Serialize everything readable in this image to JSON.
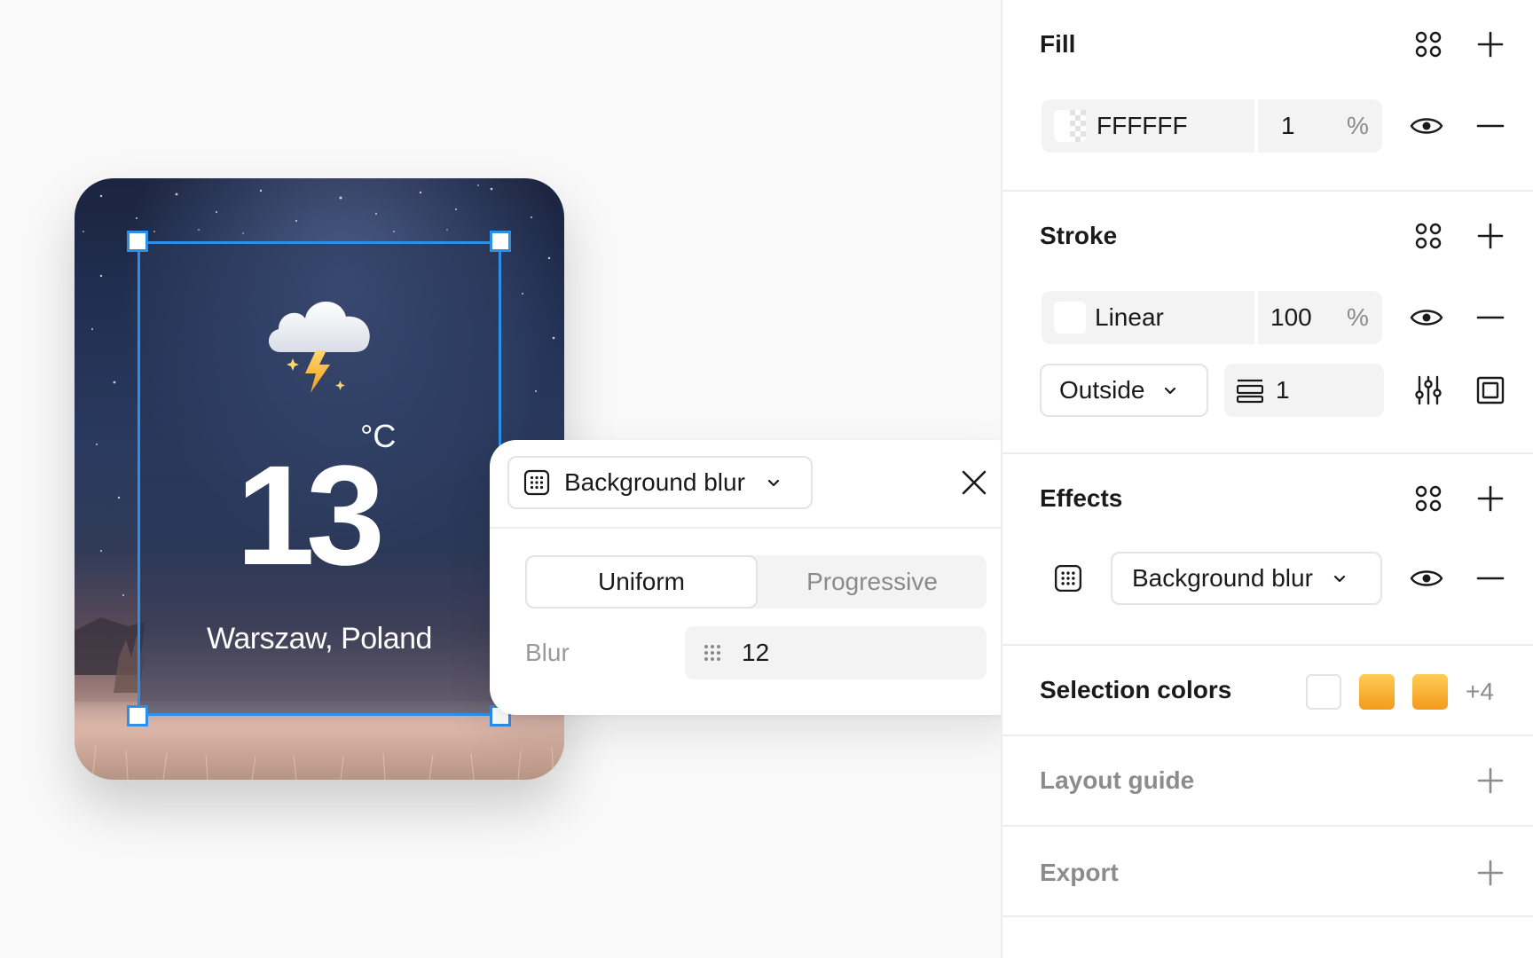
{
  "canvas": {
    "weather_card": {
      "temperature": "13",
      "unit": "°C",
      "city": "Warszaw, Poland",
      "weather_icon": "thunderstorm-cloud-icon"
    }
  },
  "popover": {
    "effect_type": "Background blur",
    "modes": [
      "Uniform",
      "Progressive"
    ],
    "active_mode": "Uniform",
    "blur_label": "Blur",
    "blur_value": "12"
  },
  "panel": {
    "fill": {
      "title": "Fill",
      "color_hex": "FFFFFF",
      "opacity": "1",
      "percent": "%"
    },
    "stroke": {
      "title": "Stroke",
      "type": "Linear",
      "opacity": "100",
      "percent": "%",
      "position": "Outside",
      "weight": "1"
    },
    "effects": {
      "title": "Effects",
      "effect_type": "Background blur"
    },
    "selection_colors": {
      "title": "Selection colors",
      "more": "+4",
      "colors": [
        "#ffffff",
        "#f7a21f",
        "#f7a21f"
      ]
    },
    "layout_guide": {
      "title": "Layout guide"
    },
    "export": {
      "title": "Export"
    }
  },
  "colors": {
    "accent": "#2d8fe6",
    "orange_gradient_start": "#ffcc55",
    "orange_gradient_end": "#f49a1c"
  }
}
